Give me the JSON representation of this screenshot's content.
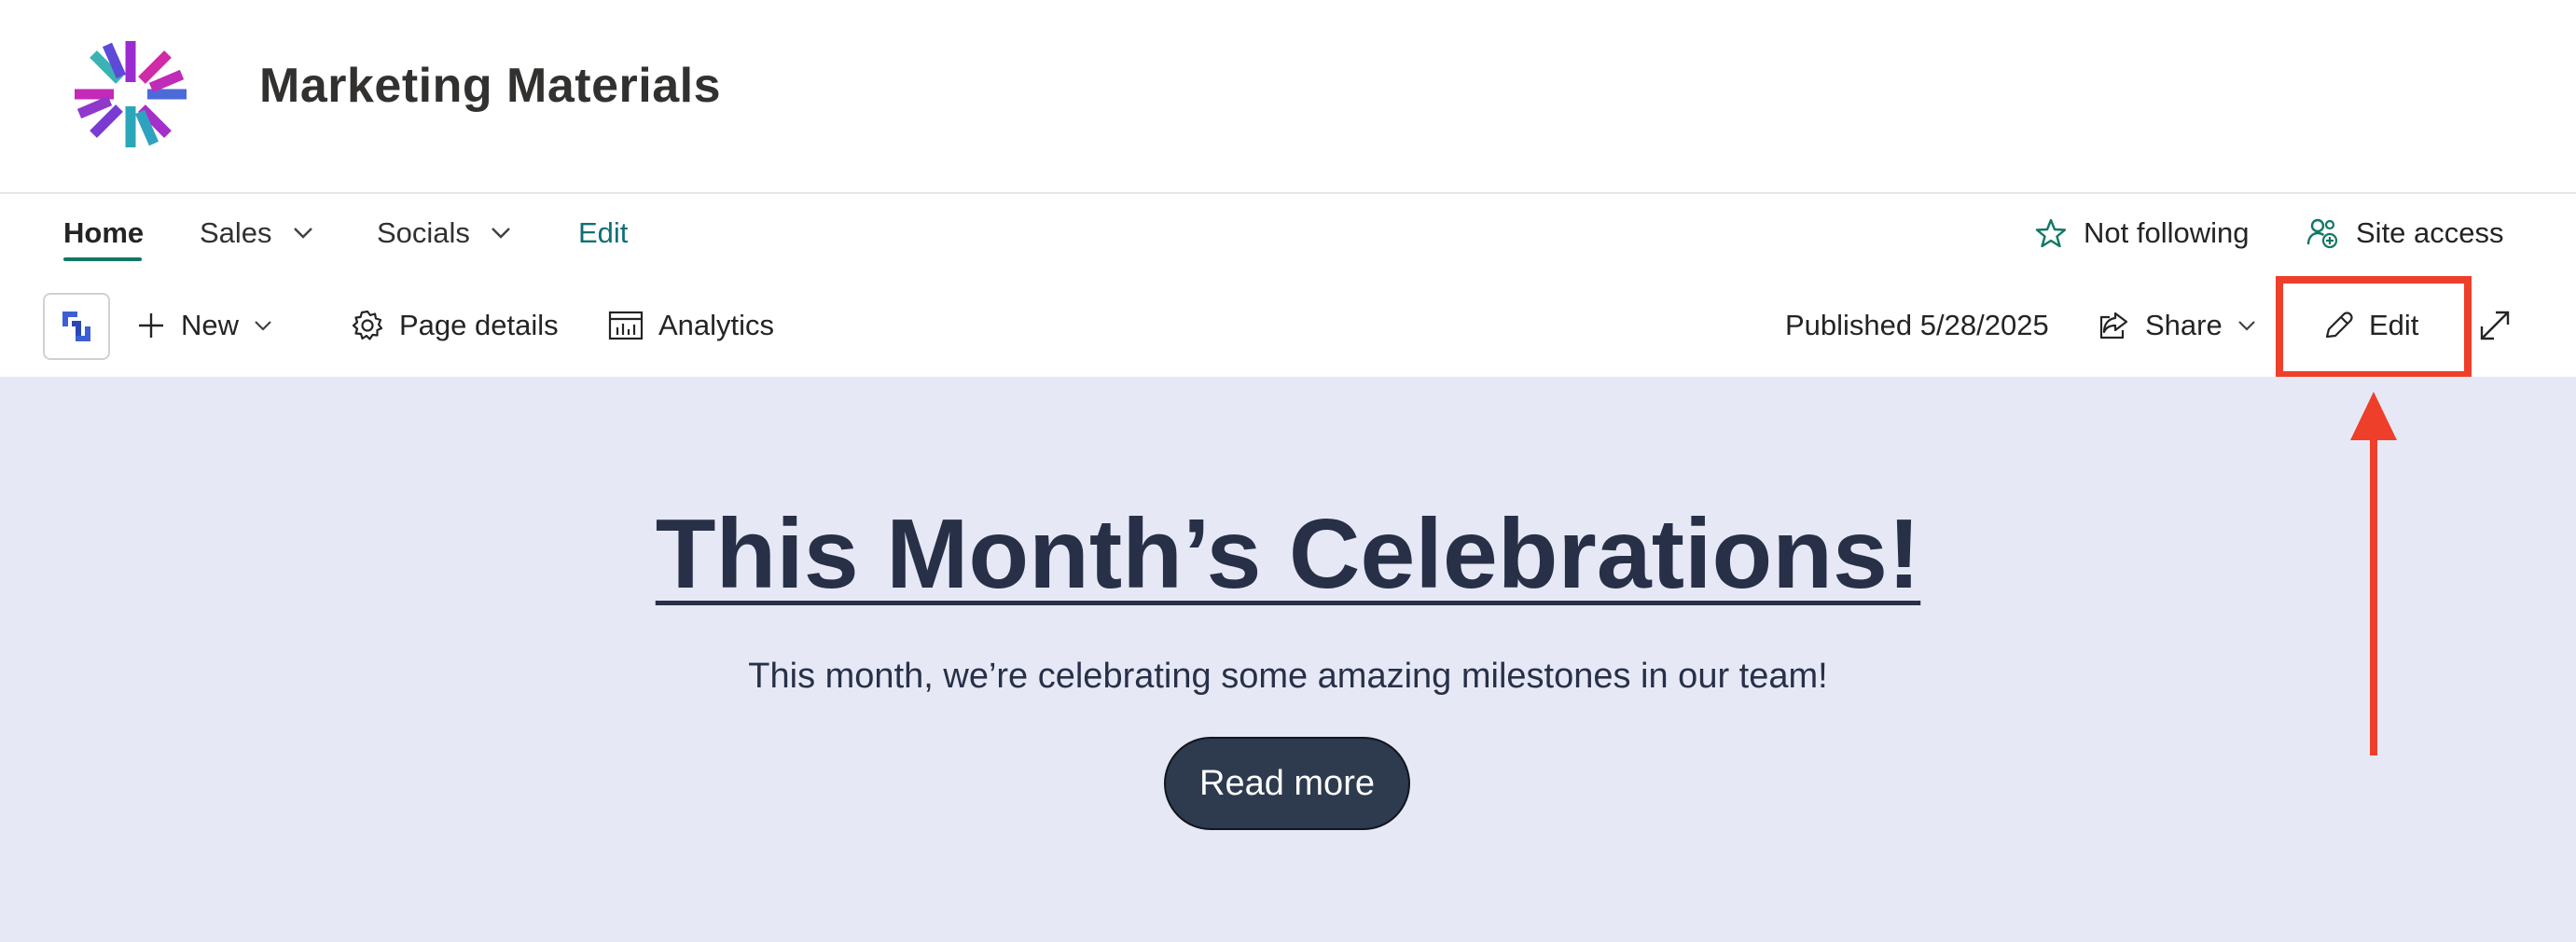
{
  "site": {
    "title": "Marketing Materials"
  },
  "nav": {
    "items": [
      {
        "label": "Home"
      },
      {
        "label": "Sales"
      },
      {
        "label": "Socials"
      }
    ],
    "edit_label": "Edit",
    "follow_label": "Not following",
    "site_access_label": "Site access"
  },
  "command_bar": {
    "new_label": "New",
    "page_details_label": "Page details",
    "analytics_label": "Analytics",
    "published_label": "Published 5/28/2025",
    "share_label": "Share",
    "edit_label": "Edit"
  },
  "hero": {
    "title": "This Month’s Celebrations!",
    "subtitle": "This month, we’re celebrating some amazing milestones in our team!",
    "button_label": "Read more"
  },
  "colors": {
    "accent_teal": "#117865",
    "hero_background": "#e6e9f5",
    "hero_text": "#283048",
    "annotation_red": "#ee3f2a",
    "button_dark": "#2e3a4e"
  },
  "icons": [
    "site-logo",
    "chevron-down-icon",
    "star-icon",
    "site-access-icon",
    "app-launcher-icon",
    "plus-icon",
    "gear-icon",
    "analytics-icon",
    "share-icon",
    "pencil-icon",
    "expand-icon"
  ]
}
